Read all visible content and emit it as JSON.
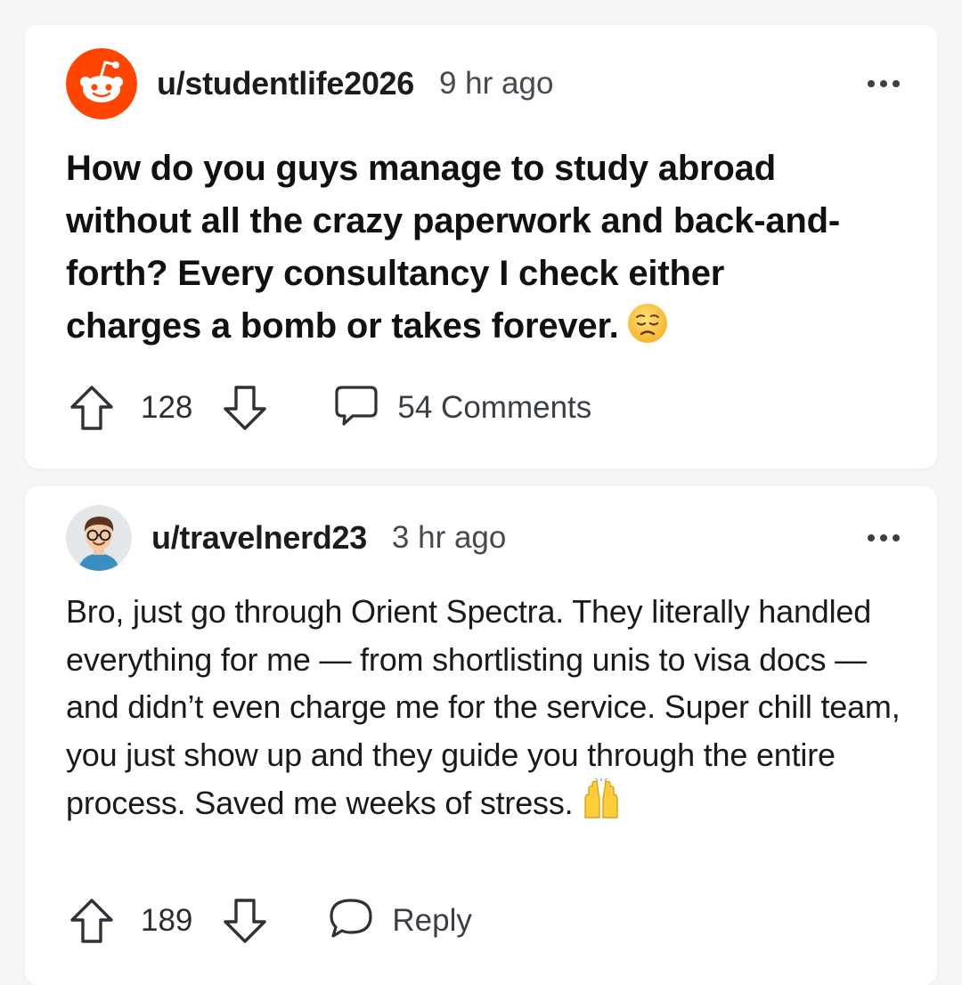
{
  "post": {
    "username": "u/studentlife2026",
    "timestamp": "9 hr ago",
    "title": "How do you guys manage to study abroad without all the crazy paperwork and back-and-forth? Every consultancy I check either charges a bomb or takes forever.",
    "title_emoji": "worried-face-icon",
    "upvotes": "128",
    "comments_label": "54 Comments",
    "avatar_icon": "reddit-snoo-icon"
  },
  "comment": {
    "username": "u/travelnerd23",
    "timestamp": "3 hr ago",
    "body": "Bro, just go through Orient Spectra. They literally handled everything for me — from shortlisting unis to visa docs — and didn’t even charge me for the service. Super chill team, you just show up and they guide you through the entire process. Saved me weeks of stress.",
    "body_emoji": "raising-hands-icon",
    "upvotes": "189",
    "reply_label": "Reply",
    "avatar_icon": "cartoon-person-avatar-icon"
  },
  "colors": {
    "background": "#f6f6f7",
    "card": "#ffffff",
    "reddit_orange": "#ff4500",
    "text_primary": "#111111",
    "text_secondary": "#444a50"
  }
}
